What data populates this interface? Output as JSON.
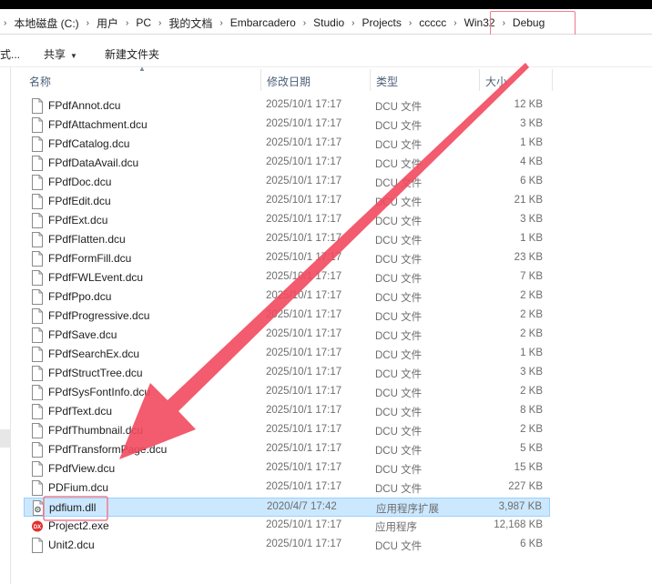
{
  "breadcrumb": [
    "本地磁盘 (C:)",
    "用户",
    "PC",
    "我的文档",
    "Embarcadero",
    "Studio",
    "Projects",
    "ccccc",
    "Win32",
    "Debug"
  ],
  "toolbar": {
    "partial_label": "式...",
    "share_label": "共享",
    "new_folder_label": "新建文件夹"
  },
  "columns": {
    "name": "名称",
    "date": "修改日期",
    "type": "类型",
    "size": "大小"
  },
  "files": [
    {
      "name": "FPdfAnnot.dcu",
      "date": "2025/10/1 17:17",
      "type": "DCU 文件",
      "size": "12 KB",
      "icon": "file-icon"
    },
    {
      "name": "FPdfAttachment.dcu",
      "date": "2025/10/1 17:17",
      "type": "DCU 文件",
      "size": "3 KB",
      "icon": "file-icon"
    },
    {
      "name": "FPdfCatalog.dcu",
      "date": "2025/10/1 17:17",
      "type": "DCU 文件",
      "size": "1 KB",
      "icon": "file-icon"
    },
    {
      "name": "FPdfDataAvail.dcu",
      "date": "2025/10/1 17:17",
      "type": "DCU 文件",
      "size": "4 KB",
      "icon": "file-icon"
    },
    {
      "name": "FPdfDoc.dcu",
      "date": "2025/10/1 17:17",
      "type": "DCU 文件",
      "size": "6 KB",
      "icon": "file-icon"
    },
    {
      "name": "FPdfEdit.dcu",
      "date": "2025/10/1 17:17",
      "type": "DCU 文件",
      "size": "21 KB",
      "icon": "file-icon"
    },
    {
      "name": "FPdfExt.dcu",
      "date": "2025/10/1 17:17",
      "type": "DCU 文件",
      "size": "3 KB",
      "icon": "file-icon"
    },
    {
      "name": "FPdfFlatten.dcu",
      "date": "2025/10/1 17:17",
      "type": "DCU 文件",
      "size": "1 KB",
      "icon": "file-icon"
    },
    {
      "name": "FPdfFormFill.dcu",
      "date": "2025/10/1 17:17",
      "type": "DCU 文件",
      "size": "23 KB",
      "icon": "file-icon"
    },
    {
      "name": "FPdfFWLEvent.dcu",
      "date": "2025/10/1 17:17",
      "type": "DCU 文件",
      "size": "7 KB",
      "icon": "file-icon"
    },
    {
      "name": "FPdfPpo.dcu",
      "date": "2025/10/1 17:17",
      "type": "DCU 文件",
      "size": "2 KB",
      "icon": "file-icon"
    },
    {
      "name": "FPdfProgressive.dcu",
      "date": "2025/10/1 17:17",
      "type": "DCU 文件",
      "size": "2 KB",
      "icon": "file-icon"
    },
    {
      "name": "FPdfSave.dcu",
      "date": "2025/10/1 17:17",
      "type": "DCU 文件",
      "size": "2 KB",
      "icon": "file-icon"
    },
    {
      "name": "FPdfSearchEx.dcu",
      "date": "2025/10/1 17:17",
      "type": "DCU 文件",
      "size": "1 KB",
      "icon": "file-icon"
    },
    {
      "name": "FPdfStructTree.dcu",
      "date": "2025/10/1 17:17",
      "type": "DCU 文件",
      "size": "3 KB",
      "icon": "file-icon"
    },
    {
      "name": "FPdfSysFontInfo.dcu",
      "date": "2025/10/1 17:17",
      "type": "DCU 文件",
      "size": "2 KB",
      "icon": "file-icon"
    },
    {
      "name": "FPdfText.dcu",
      "date": "2025/10/1 17:17",
      "type": "DCU 文件",
      "size": "8 KB",
      "icon": "file-icon"
    },
    {
      "name": "FPdfThumbnail.dcu",
      "date": "2025/10/1 17:17",
      "type": "DCU 文件",
      "size": "2 KB",
      "icon": "file-icon"
    },
    {
      "name": "FPdfTransformPage.dcu",
      "date": "2025/10/1 17:17",
      "type": "DCU 文件",
      "size": "5 KB",
      "icon": "file-icon"
    },
    {
      "name": "FPdfView.dcu",
      "date": "2025/10/1 17:17",
      "type": "DCU 文件",
      "size": "15 KB",
      "icon": "file-icon"
    },
    {
      "name": "PDFium.dcu",
      "date": "2025/10/1 17:17",
      "type": "DCU 文件",
      "size": "227 KB",
      "icon": "file-icon"
    },
    {
      "name": "pdfium.dll",
      "date": "2020/4/7 17:42",
      "type": "应用程序扩展",
      "size": "3,987 KB",
      "icon": "dll-gear-icon",
      "selected": true
    },
    {
      "name": "Project2.exe",
      "date": "2025/10/1 17:17",
      "type": "应用程序",
      "size": "12,168 KB",
      "icon": "delphi-app-icon"
    },
    {
      "name": "Unit2.dcu",
      "date": "2025/10/1 17:17",
      "type": "DCU 文件",
      "size": "6 KB",
      "icon": "file-icon"
    }
  ],
  "colors": {
    "annotation": "#f2495e",
    "selection_bg": "#cce8ff",
    "selection_border": "#99d1ff",
    "highlight_box": "#f07b8d"
  }
}
